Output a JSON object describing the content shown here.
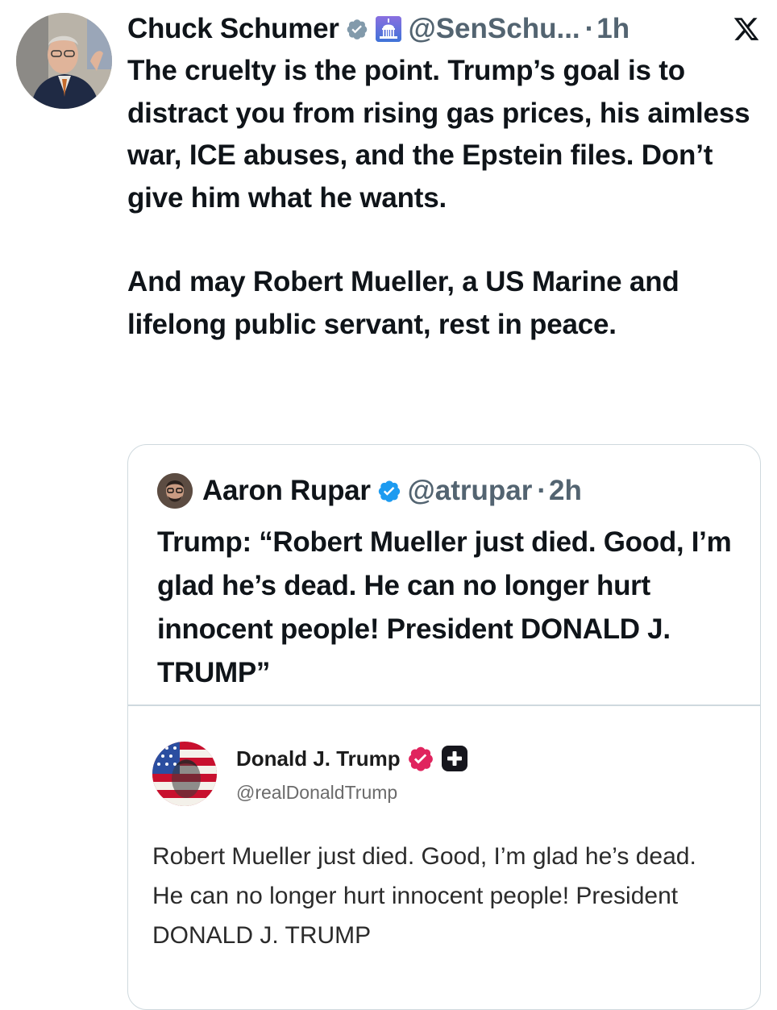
{
  "main_tweet": {
    "author_name": "Chuck Schumer",
    "handle": "@SenSchu...",
    "separator": "·",
    "time": "1h",
    "verified_icon": "verified-gray-badge-icon",
    "affiliate_icon": "capitol-building-icon",
    "platform_icon": "x-logo-icon",
    "paragraphs": [
      "The cruelty is the point. Trump’s goal is to distract you from rising gas prices, his aimless war, ICE abuses, and the Epstein files. Don’t give him what he wants.",
      "And may Robert Mueller, a US Marine and lifelong public servant, rest in peace."
    ]
  },
  "quoted_tweet": {
    "author_name": "Aaron Rupar",
    "handle": "@atrupar",
    "separator": "·",
    "time": "2h",
    "verified_icon": "verified-blue-badge-icon",
    "text": "Trump: “Robert Mueller just died. Good, I’m glad he’s dead. He can no longer hurt innocent people! President DONALD J. TRUMP”"
  },
  "embedded_post": {
    "author_name": "Donald J. Trump",
    "handle": "@realDonaldTrump",
    "verified_icon": "verified-red-badge-icon",
    "plus_icon": "plus-badge-icon",
    "text": "Robert Mueller just died. Good, I’m glad he’s dead. He can no longer hurt innocent people! President DONALD J. TRUMP"
  },
  "colors": {
    "text_primary": "#0f1419",
    "text_secondary": "#536471",
    "border": "#cfd9de",
    "verified_blue": "#1d9bf0",
    "verified_gray": "#829aab",
    "verified_red": "#e0245e"
  }
}
